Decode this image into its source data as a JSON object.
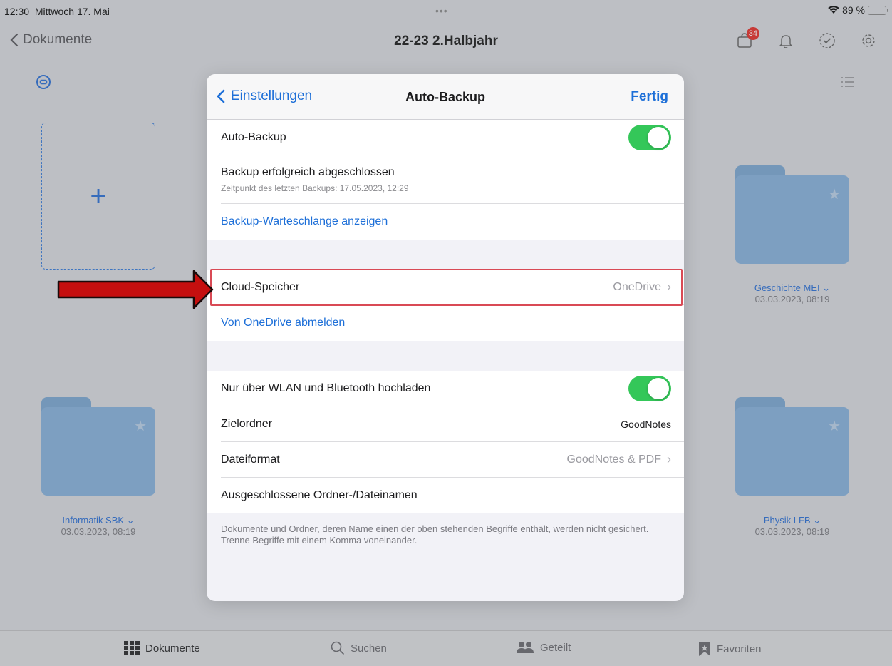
{
  "status": {
    "time": "12:30",
    "date": "Mittwoch 17. Mai",
    "dots": "•••",
    "battery": "89 %"
  },
  "nav": {
    "back_label": "Dokumente",
    "title": "22-23 2.Halbjahr",
    "badge_count": "34"
  },
  "grid": {
    "new_symbol": "+",
    "folders": [
      {
        "name": "Geschichte MEI",
        "date": "03.03.2023, 08:19"
      },
      {
        "name": "Informatik SBK",
        "date": "03.03.2023, 08:19"
      },
      {
        "name": "Physik LFB",
        "date": "03.03.2023, 08:19"
      }
    ],
    "chevron": "⌄"
  },
  "tabbar": {
    "tabs": [
      {
        "label": "Dokumente",
        "icon": "grid-icon"
      },
      {
        "label": "Suchen",
        "icon": "search-icon"
      },
      {
        "label": "Geteilt",
        "icon": "people-icon"
      },
      {
        "label": "Favoriten",
        "icon": "bookmark-icon"
      }
    ]
  },
  "modal": {
    "back_label": "Einstellungen",
    "title": "Auto-Backup",
    "done_label": "Fertig",
    "section1": {
      "auto_backup_label": "Auto-Backup",
      "auto_backup_on": true,
      "status_title": "Backup erfolgreich abgeschlossen",
      "status_sub": "Zeitpunkt des letzten Backups: 17.05.2023, 12:29",
      "queue_link": "Backup-Warteschlange anzeigen"
    },
    "section2": {
      "cloud_label": "Cloud-Speicher",
      "cloud_value": "OneDrive",
      "signout_link": "Von OneDrive abmelden"
    },
    "section3": {
      "wlan_label": "Nur über WLAN und Bluetooth hochladen",
      "wlan_on": true,
      "target_label": "Zielordner",
      "target_value": "GoodNotes",
      "format_label": "Dateiformat",
      "format_value": "GoodNotes & PDF",
      "excluded_label": "Ausgeschlossene Ordner-/Dateinamen"
    },
    "footnote": "Dokumente und Ordner, deren Name einen der oben stehenden Begriffe enthält, werden nicht gesichert. Trenne Begriffe mit einem Komma voneinander."
  },
  "colors": {
    "accent": "#1d6fd8",
    "toggle_on": "#34c759",
    "highlight": "#d94a55",
    "arrow": "#c50f0f"
  }
}
